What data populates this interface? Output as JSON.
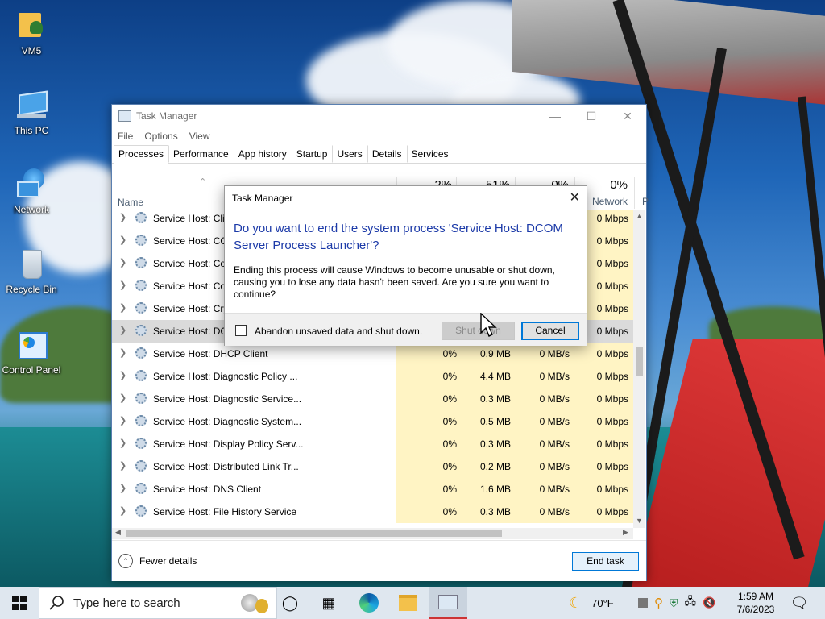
{
  "desktop": {
    "icons": [
      {
        "label": "VM5",
        "icon": "user-folder-icon"
      },
      {
        "label": "This PC",
        "icon": "computer-icon"
      },
      {
        "label": "Network",
        "icon": "network-icon"
      },
      {
        "label": "Recycle Bin",
        "icon": "recycle-bin-icon"
      },
      {
        "label": "Control Panel",
        "icon": "control-panel-icon"
      }
    ]
  },
  "window": {
    "title": "Task Manager",
    "menu": [
      "File",
      "Options",
      "View"
    ],
    "tabs": [
      "Processes",
      "Performance",
      "App history",
      "Startup",
      "Users",
      "Details",
      "Services"
    ],
    "active_tab": "Processes",
    "columns": {
      "name": "Name",
      "cpu_pct": "2%",
      "memory_pct": "51%",
      "disk_pct": "0%",
      "network_pct": "0%",
      "network": "Network",
      "power_partial": "P"
    },
    "rows": [
      {
        "name": "Service Host: Clip",
        "cpu": "",
        "memory": "",
        "disk": "",
        "network": "0 Mbps"
      },
      {
        "name": "Service Host: COI",
        "cpu": "",
        "memory": "",
        "disk": "",
        "network": "0 Mbps"
      },
      {
        "name": "Service Host: Cor",
        "cpu": "",
        "memory": "",
        "disk": "",
        "network": "0 Mbps"
      },
      {
        "name": "Service Host: Cor",
        "cpu": "",
        "memory": "",
        "disk": "",
        "network": "0 Mbps"
      },
      {
        "name": "Service Host: Cry",
        "cpu": "",
        "memory": "",
        "disk": "",
        "network": "0 Mbps"
      },
      {
        "name": "Service Host: DCOM Server Proc...",
        "cpu": "",
        "memory": "",
        "disk": "",
        "network": "0 Mbps",
        "selected": true
      },
      {
        "name": "Service Host: DHCP Client",
        "cpu": "0%",
        "memory": "0.9 MB",
        "disk": "0 MB/s",
        "network": "0 Mbps"
      },
      {
        "name": "Service Host: Diagnostic Policy ...",
        "cpu": "0%",
        "memory": "4.4 MB",
        "disk": "0 MB/s",
        "network": "0 Mbps"
      },
      {
        "name": "Service Host: Diagnostic Service...",
        "cpu": "0%",
        "memory": "0.3 MB",
        "disk": "0 MB/s",
        "network": "0 Mbps"
      },
      {
        "name": "Service Host: Diagnostic System...",
        "cpu": "0%",
        "memory": "0.5 MB",
        "disk": "0 MB/s",
        "network": "0 Mbps"
      },
      {
        "name": "Service Host: Display Policy Serv...",
        "cpu": "0%",
        "memory": "0.3 MB",
        "disk": "0 MB/s",
        "network": "0 Mbps"
      },
      {
        "name": "Service Host: Distributed Link Tr...",
        "cpu": "0%",
        "memory": "0.2 MB",
        "disk": "0 MB/s",
        "network": "0 Mbps"
      },
      {
        "name": "Service Host: DNS Client",
        "cpu": "0%",
        "memory": "1.6 MB",
        "disk": "0 MB/s",
        "network": "0 Mbps"
      },
      {
        "name": "Service Host: File History Service",
        "cpu": "0%",
        "memory": "0.3 MB",
        "disk": "0 MB/s",
        "network": "0 Mbps"
      }
    ],
    "fewer_details": "Fewer details",
    "end_task": "End task"
  },
  "dialog": {
    "title": "Task Manager",
    "heading": "Do you want to end the system process 'Service Host: DCOM Server Process Launcher'?",
    "body": "Ending this process will cause Windows to become unusable or shut down, causing you to lose any data hasn't been saved. Are you sure you want to continue?",
    "checkbox_label": "Abandon unsaved data and shut down.",
    "checkbox_checked": false,
    "shutdown_label": "Shut down",
    "cancel_label": "Cancel"
  },
  "taskbar": {
    "search_placeholder": "Type here to search",
    "weather": "70°F",
    "time": "1:59 AM",
    "date": "7/6/2023"
  },
  "colors": {
    "accent": "#0078d7",
    "dialog_heading": "#1c3aa8",
    "heat_cell": "#fff4c4"
  }
}
